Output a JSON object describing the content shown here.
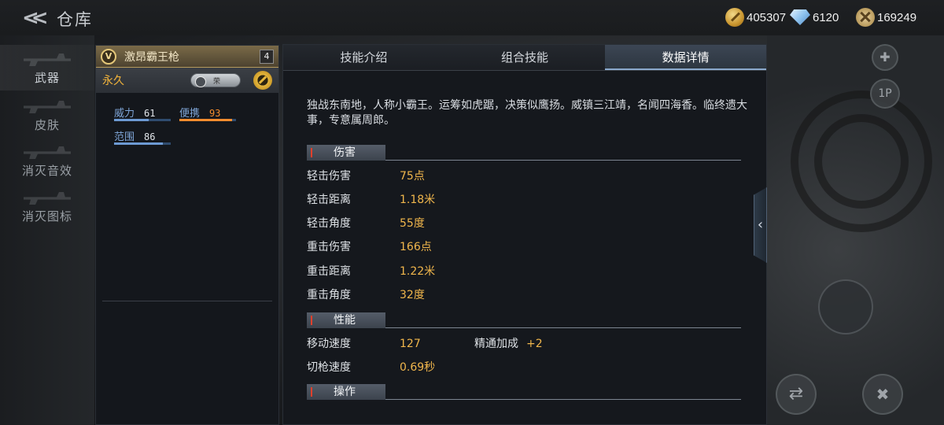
{
  "app": {
    "back_label": "返回",
    "page_title": "仓库"
  },
  "currencies": [
    {
      "icon": "gold-coin-icon",
      "value": "405307"
    },
    {
      "icon": "diamond-icon",
      "value": "6120"
    },
    {
      "icon": "honor-badge-icon",
      "value": "169249"
    }
  ],
  "nav": {
    "items": [
      {
        "label": "武器",
        "active": true
      },
      {
        "label": "皮肤",
        "active": false
      },
      {
        "label": "消灭音效",
        "active": false
      },
      {
        "label": "消灭图标",
        "active": false
      }
    ]
  },
  "weapon": {
    "rank": "V",
    "name": "激昂霸王枪",
    "count": "4",
    "duration": "永久",
    "tag": "荣",
    "stats": [
      {
        "name": "威力",
        "value": "61",
        "fill": 0.61,
        "highlight": false
      },
      {
        "name": "便携",
        "value": "93",
        "fill": 0.93,
        "highlight": true
      },
      {
        "name": "范围",
        "value": "86",
        "fill": 0.86,
        "highlight": false
      }
    ]
  },
  "tabs": [
    {
      "label": "技能介绍",
      "active": false
    },
    {
      "label": "组合技能",
      "active": false
    },
    {
      "label": "数据详情",
      "active": true
    }
  ],
  "detail": {
    "description": "独战东南地，人称小霸王。运筹如虎踞，决策似鹰扬。威镇三江靖，名闻四海香。临终遗大事，专意属周郎。",
    "sections": {
      "damage": "伤害",
      "performance": "性能",
      "operation": "操作"
    },
    "damage_rows": [
      {
        "label": "轻击伤害",
        "value": "75点"
      },
      {
        "label": "轻击距离",
        "value": "1.18米"
      },
      {
        "label": "轻击角度",
        "value": "55度"
      },
      {
        "label": "重击伤害",
        "value": "166点"
      },
      {
        "label": "重击距离",
        "value": "1.22米"
      },
      {
        "label": "重击角度",
        "value": "32度"
      }
    ],
    "performance_rows": [
      {
        "label": "移动速度",
        "value": "127",
        "extra_label": "精通加成",
        "extra_value": "+2"
      },
      {
        "label": "切枪速度",
        "value": "0.69秒"
      }
    ]
  },
  "right_hud": {
    "view_label": "1P"
  },
  "colors": {
    "accent_gold": "#f0b64c",
    "stat_blue": "#7fa6d8",
    "highlight_orange": "#f28c2e",
    "tab_active": "#3c4654"
  }
}
